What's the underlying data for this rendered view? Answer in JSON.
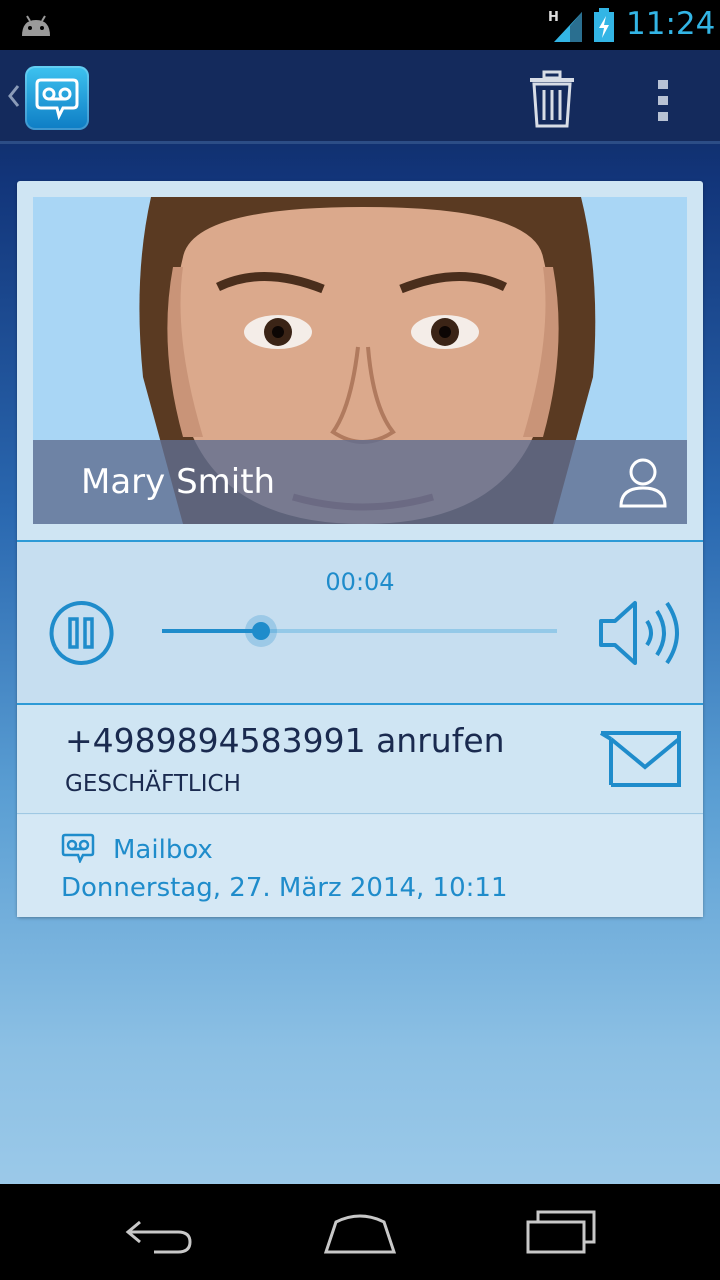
{
  "status_bar": {
    "time": "11:24",
    "network_type": "H",
    "icons": [
      "android-debug-icon",
      "signal-icon",
      "battery-charging-icon"
    ],
    "accent_color": "#33b5e5"
  },
  "action_bar": {
    "icons": {
      "up": "chevron-left-icon",
      "app": "voicemail-icon",
      "delete": "trash-icon",
      "overflow": "overflow-menu-icon"
    }
  },
  "contact": {
    "name": "Mary Smith",
    "icon": "person-icon"
  },
  "player": {
    "elapsed": "00:04",
    "progress": 0.25,
    "icons": {
      "play_state": "pause-icon",
      "speaker": "speaker-icon"
    },
    "accent_color": "#1f8ccb"
  },
  "call": {
    "label": "+4989894583991 anrufen",
    "type": "GESCHÄFTLICH",
    "icon": "envelope-icon"
  },
  "info": {
    "source": "Mailbox",
    "date": "Donnerstag, 27. März 2014, 10:11",
    "icon": "voicemail-icon"
  },
  "nav_bar": {
    "icons": [
      "back-icon",
      "home-icon",
      "recents-icon"
    ]
  }
}
